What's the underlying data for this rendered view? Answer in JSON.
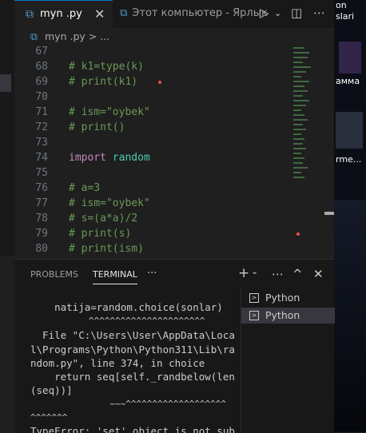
{
  "tabs": {
    "active": {
      "label": "myn .py",
      "close": "✕"
    },
    "second": {
      "label": "Этот компьютер - Ярлык"
    }
  },
  "breadcrumb": {
    "path": "myn .py > ..."
  },
  "editor": {
    "lines": [
      {
        "num": "67",
        "text": ""
      },
      {
        "num": "68",
        "text": "# k1=type(k)"
      },
      {
        "num": "69",
        "text": "# print(k1)"
      },
      {
        "num": "70",
        "text": ""
      },
      {
        "num": "71",
        "text": "# ism=\"oybek\""
      },
      {
        "num": "72",
        "text": "# print()"
      },
      {
        "num": "73",
        "text": ""
      },
      {
        "num": "74",
        "kw": "import",
        "mod": "random"
      },
      {
        "num": "75",
        "text": ""
      },
      {
        "num": "76",
        "text": "# a=3"
      },
      {
        "num": "77",
        "text": "# ism=\"oybek\""
      },
      {
        "num": "78",
        "text": "# s=(a*a)/2"
      },
      {
        "num": "79",
        "text": "# print(s)"
      },
      {
        "num": "80",
        "text": "# print(ism)"
      }
    ]
  },
  "panel": {
    "problems": "PROBLEMS",
    "terminal": "TERMINAL",
    "more": "···",
    "terminal_lines": [
      "    natija=random.choice(sonlar)",
      "           ^^^^^^^^^^^^^^^^^^^^^^",
      "  File \"C:\\Users\\User\\AppData\\Loca",
      "l\\Programs\\Python\\Python311\\Lib\\ra",
      "ndom.py\", line 374, in choice",
      "    return seq[self._randbelow(len",
      "(seq))]",
      "               ~~~^^^^^^^^^^^^^^^^^^^",
      "^^^^^^^",
      "TypeError: 'set' object is not sub"
    ],
    "terminals": [
      {
        "label": "Python"
      },
      {
        "label": "Python"
      }
    ]
  },
  "desktop": {
    "label1": "on",
    "label2": "slari",
    "label3": "амма",
    "label4": "rme..."
  }
}
